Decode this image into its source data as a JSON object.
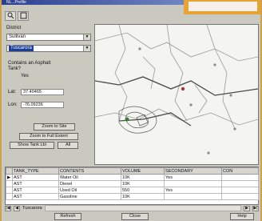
{
  "window": {
    "title": "NL...Profile"
  },
  "left_panel": {
    "section_label": "District",
    "district_select": {
      "value": "Sullivan"
    },
    "site_select": {
      "value": "Tuscarora"
    },
    "question_label": "Contains an Asphalt Tank?",
    "question_value": "Yes",
    "lat_label": "Lat:",
    "lat_value": "37.40465",
    "lon_label": "Lon:",
    "lon_value": "-76.09236",
    "buttons": [
      "Zoom to Site",
      "Zoom to Full Extent",
      "Show Tank Lbl",
      "All"
    ]
  },
  "grid": {
    "columns": [
      "",
      "TANK_TYPE",
      "CONTENTS",
      "VOLUME",
      "SECONDARY",
      "CON"
    ],
    "rows": [
      [
        "",
        "AST",
        "Water Oil",
        "10K",
        "Yes",
        ""
      ],
      [
        "",
        "AST",
        "Diesel",
        "10K",
        "",
        ""
      ],
      [
        "",
        "AST",
        "Used Oil",
        "550",
        "Yes",
        ""
      ],
      [
        "",
        "AST",
        "Gasoline",
        "10K",
        "",
        ""
      ]
    ]
  },
  "record_bar": {
    "value": "Tuscarora"
  },
  "bottom_buttons": [
    "Refresh",
    "Close",
    "Help"
  ]
}
